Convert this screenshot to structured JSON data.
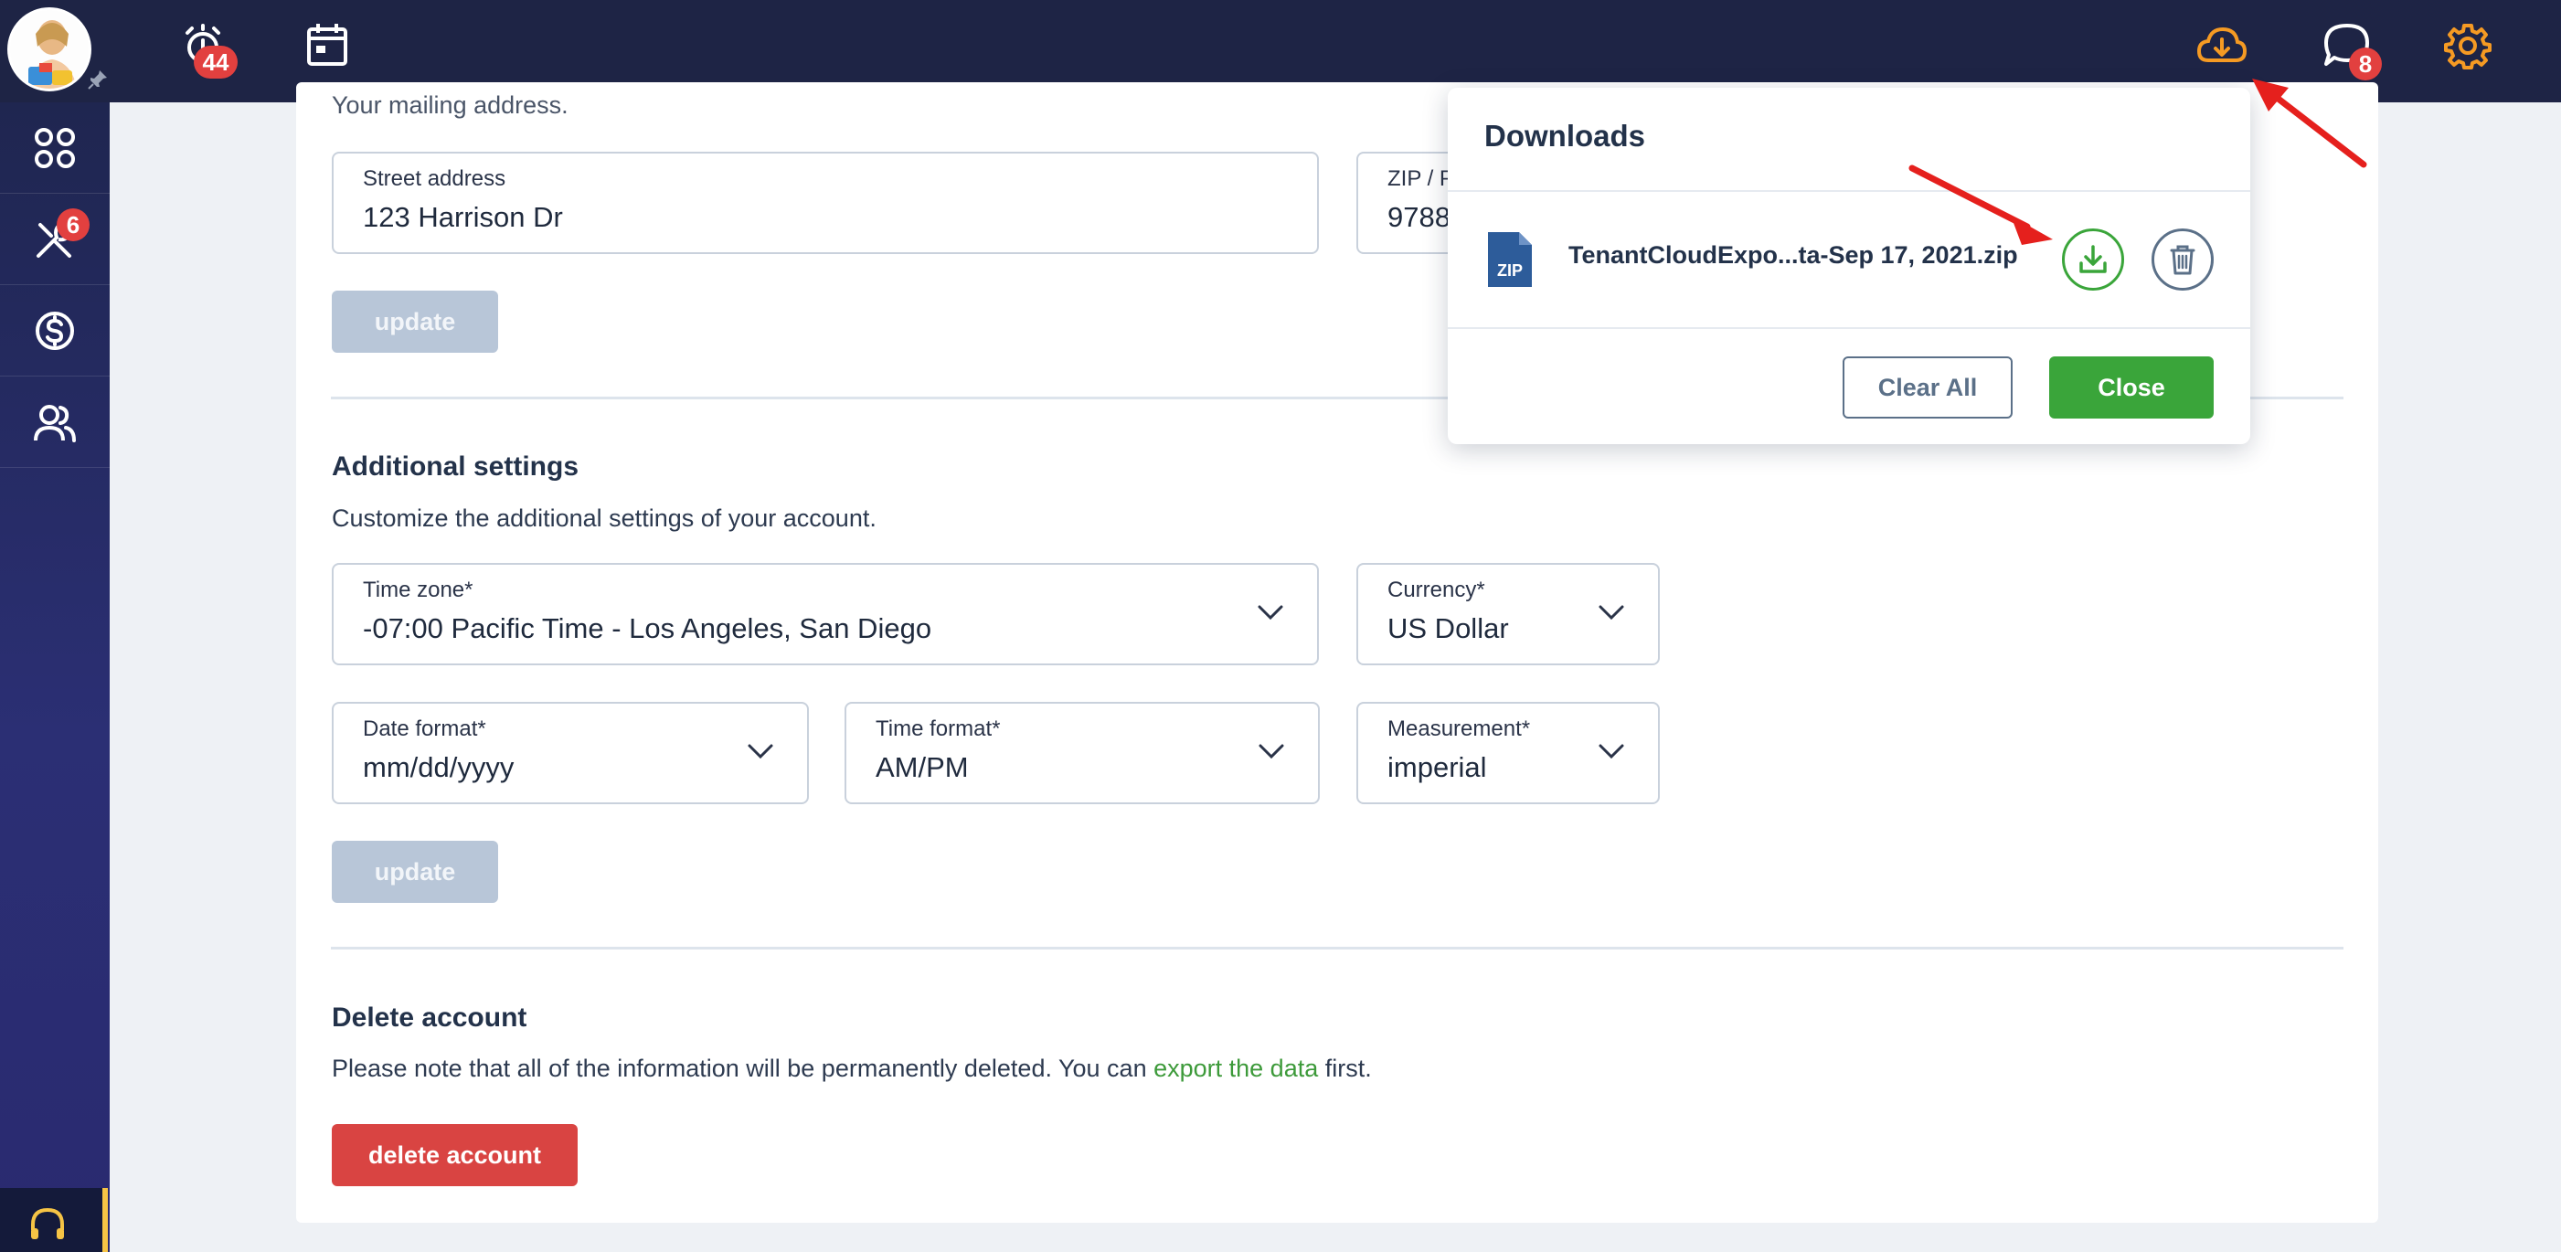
{
  "topbar": {
    "alerts_badge": "44",
    "messages_badge": "8",
    "accent_color": "#f59a23"
  },
  "sidebar": {
    "maintenance_badge": "6",
    "items": [
      {
        "icon": "dashboard-icon"
      },
      {
        "icon": "tools-icon"
      },
      {
        "icon": "dollar-icon"
      },
      {
        "icon": "users-icon"
      }
    ],
    "support_icon": "headset-icon"
  },
  "address": {
    "partial_heading": "Your mailing address.",
    "street_label": "Street address",
    "street_value": "123 Harrison Dr",
    "zip_label_partial": "ZIP / P",
    "zip_value_partial": "9788",
    "update_label": "update"
  },
  "additional": {
    "title": "Additional settings",
    "subtitle": "Customize the additional settings of your account.",
    "timezone_label": "Time zone*",
    "timezone_value": "-07:00 Pacific Time - Los Angeles, San Diego",
    "currency_label": "Currency*",
    "currency_value": "US Dollar",
    "date_format_label": "Date format*",
    "date_format_value": "mm/dd/yyyy",
    "time_format_label": "Time format*",
    "time_format_value": "AM/PM",
    "measurement_label": "Measurement*",
    "measurement_value": "imperial",
    "update_label": "update"
  },
  "delete_section": {
    "title": "Delete account",
    "note_before": "Please note that all of the information will be permanently deleted. You can ",
    "note_link": "export the data",
    "note_after": " first.",
    "button_label": "delete account"
  },
  "downloads": {
    "title": "Downloads",
    "file_type": "ZIP",
    "file_name": "TenantCloudExpo...ta-Sep 17, 2021.zip",
    "clear_label": "Clear All",
    "close_label": "Close"
  },
  "colors": {
    "navy": "#1e2445",
    "green": "#3aa53a",
    "red": "#d94442",
    "disabled": "#b8c6d8"
  }
}
